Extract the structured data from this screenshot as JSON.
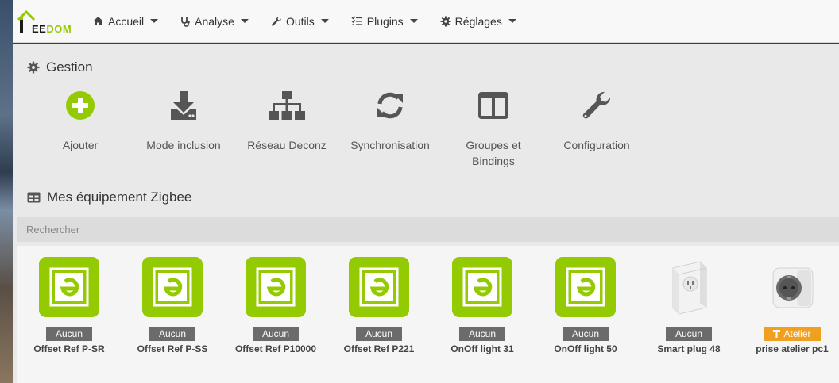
{
  "colors": {
    "brand": "#94ca02",
    "badge_default": "#6b6b6b",
    "badge_atelier": "#f0a020"
  },
  "logo": {
    "text_prefix": "EE",
    "text_suffix": "DOM"
  },
  "nav": [
    {
      "label": "Accueil",
      "icon": "home-icon"
    },
    {
      "label": "Analyse",
      "icon": "stethoscope-icon"
    },
    {
      "label": "Outils",
      "icon": "wrench-icon"
    },
    {
      "label": "Plugins",
      "icon": "tasks-icon"
    },
    {
      "label": "Réglages",
      "icon": "cogs-icon"
    }
  ],
  "gestion": {
    "title": "Gestion",
    "actions": [
      {
        "label": "Ajouter",
        "icon": "plus-circle-icon"
      },
      {
        "label": "Mode inclusion",
        "icon": "download-icon"
      },
      {
        "label": "Réseau Deconz",
        "icon": "sitemap-icon"
      },
      {
        "label": "Synchronisation",
        "icon": "sync-icon"
      },
      {
        "label": "Groupes et Bindings",
        "icon": "columns-icon"
      },
      {
        "label": "Configuration",
        "icon": "wrench-icon"
      }
    ]
  },
  "equipements": {
    "title": "Mes équipement Zigbee",
    "search_placeholder": "Rechercher",
    "items": [
      {
        "object": "Aucun",
        "name": "Offset Ref P-SR",
        "image": "zigbee-logo-icon"
      },
      {
        "object": "Aucun",
        "name": "Offset Ref P-SS",
        "image": "zigbee-logo-icon"
      },
      {
        "object": "Aucun",
        "name": "Offset Ref P10000",
        "image": "zigbee-logo-icon"
      },
      {
        "object": "Aucun",
        "name": "Offset Ref P221",
        "image": "zigbee-logo-icon"
      },
      {
        "object": "Aucun",
        "name": "OnOff light 31",
        "image": "zigbee-logo-icon"
      },
      {
        "object": "Aucun",
        "name": "OnOff light 50",
        "image": "zigbee-logo-icon"
      },
      {
        "object": "Aucun",
        "name": "Smart plug 48",
        "image": "smart-plug-image"
      },
      {
        "object": "Atelier",
        "name": "prise atelier pc1",
        "image": "socket-plug-image",
        "object_icon": "hammer-icon"
      }
    ]
  }
}
